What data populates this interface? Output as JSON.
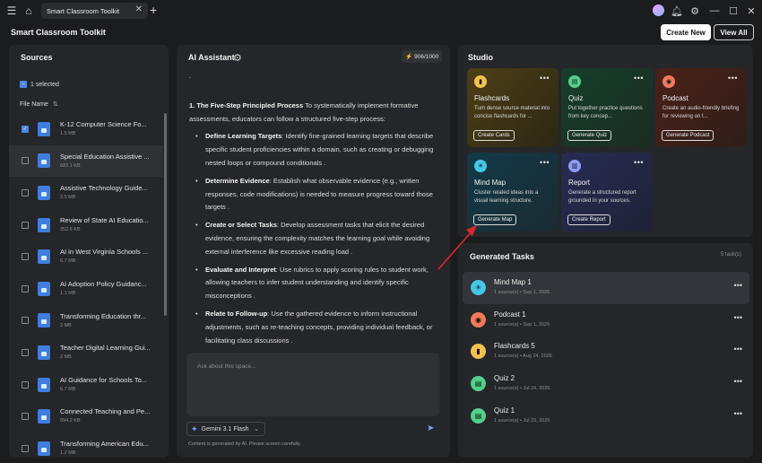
{
  "window": {
    "tab_title": "Smart Classroom Toolkit",
    "app_title": "Smart Classroom Toolkit"
  },
  "header": {
    "create_new": "Create New",
    "view_all": "View All"
  },
  "sources": {
    "title": "Sources",
    "selected_label": "1 selected",
    "column_label": "File Name",
    "items": [
      {
        "name": "K-12 Computer Science Fo...",
        "size": "1.5 MB",
        "checked": true
      },
      {
        "name": "Special Education Assistive ...",
        "size": "683.1 KB",
        "checked": false
      },
      {
        "name": "Assistive Technology Guide...",
        "size": "3.5 MB",
        "checked": false
      },
      {
        "name": "Review of State AI Educatio...",
        "size": "352.6 KB",
        "checked": false
      },
      {
        "name": "AI in West Virginia Schools ...",
        "size": "6.7 MB",
        "checked": false
      },
      {
        "name": "AI Adoption Policy Guidanc...",
        "size": "1.1 MB",
        "checked": false
      },
      {
        "name": "Transforming Education thr...",
        "size": "3 MB",
        "checked": false
      },
      {
        "name": "Teacher Digital Learning Gui...",
        "size": "2 MB",
        "checked": false
      },
      {
        "name": "AI Guidance for Schools To...",
        "size": "6.7 MB",
        "checked": false
      },
      {
        "name": "Connected Teaching and Pe...",
        "size": "994.2 KB",
        "checked": false
      },
      {
        "name": "Transforming American Edu...",
        "size": "1.2 MB",
        "checked": false
      }
    ]
  },
  "assistant": {
    "title": "AI Assistant",
    "quota": "906/1000",
    "dot": ".",
    "lead_heading": "1. The Five-Step Principled Process",
    "lead_text": " To systematically implement formative assessments, educators can follow a structured five-step process:",
    "steps": [
      {
        "heading": "Define Learning Targets",
        "text": ": Identify fine-grained learning targets that describe specific student proficiencies within a domain, such as creating or debugging nested loops or compound conditionals ."
      },
      {
        "heading": "Determine Evidence",
        "text": ": Establish what observable evidence (e.g., written responses, code modifications) is needed to measure progress toward those targets ."
      },
      {
        "heading": "Create or Select Tasks",
        "text": ": Develop assessment tasks that elicit the desired evidence, ensuring the complexity matches the learning goal while avoiding external interference like excessive reading load ."
      },
      {
        "heading": "Evaluate and Interpret",
        "text": ": Use rubrics to apply scoring rules to student work, allowing teachers to infer student understanding and identify specific misconceptions ."
      },
      {
        "heading": "Relate to Follow-up",
        "text": ": Use the gathered evidence to inform instructional adjustments, such as re-teaching concepts, providing individual feedback, or facilitating class discussions ."
      }
    ],
    "input_placeholder": "Ask about this space...",
    "model": "Gemini 3.1 Flash",
    "disclaimer": "Content is generated by AI. Please screen carefully."
  },
  "studio": {
    "title": "Studio",
    "cards": [
      {
        "title": "Flashcards",
        "desc": "Turn dense source material into concise flashcards for ...",
        "button": "Create Cards",
        "color": "#f2c14e"
      },
      {
        "title": "Quiz",
        "desc": "Put together practice questions from key concep...",
        "button": "Generate Quiz",
        "color": "#52d08a"
      },
      {
        "title": "Podcast",
        "desc": "Create an audio-friendly briefing for reviewing on t...",
        "button": "Generate Podcast",
        "color": "#f07a5a"
      },
      {
        "title": "Mind Map",
        "desc": "Cluster related ideas into a visual learning structure.",
        "button": "Generate Map",
        "color": "#45c7e6"
      },
      {
        "title": "Report",
        "desc": "Generate a structured report grounded in your sources.",
        "button": "Create Report",
        "color": "#8c9cf5"
      }
    ]
  },
  "tasks": {
    "title": "Generated Tasks",
    "count": "5 task(s)",
    "items": [
      {
        "name": "Mind Map 1",
        "meta": "1 source(s) • Sep 1, 2026",
        "color": "#45c7e6"
      },
      {
        "name": "Podcast 1",
        "meta": "1 source(s) • Sep 1, 2026",
        "color": "#f07a5a"
      },
      {
        "name": "Flashcards 5",
        "meta": "1 source(s) • Aug 24, 2026",
        "color": "#f2c14e"
      },
      {
        "name": "Quiz 2",
        "meta": "1 source(s) • Jul 24, 2026",
        "color": "#52d08a"
      },
      {
        "name": "Quiz 1",
        "meta": "1 source(s) • Jul 23, 2026",
        "color": "#52d08a"
      }
    ]
  }
}
